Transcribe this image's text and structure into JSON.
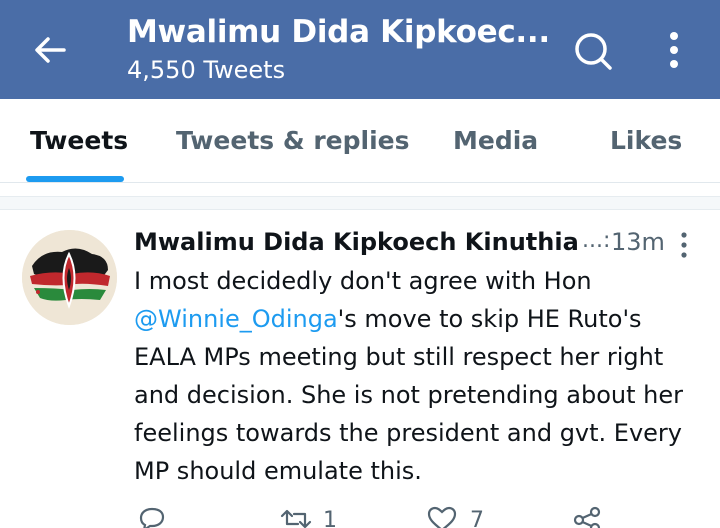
{
  "header": {
    "title": "Mwalimu Dida Kipkoec...",
    "subtitle": "4,550 Tweets",
    "back_icon": "arrow-left-icon",
    "search_icon": "search-icon",
    "more_icon": "more-vertical-icon",
    "background_color": "#4a6da7"
  },
  "tabs": [
    {
      "label": "Tweets",
      "active": true
    },
    {
      "label": "Tweets & replies",
      "active": false
    },
    {
      "label": "Media",
      "active": false
    },
    {
      "label": "Likes",
      "active": false
    }
  ],
  "tweet": {
    "author": "Mwalimu Dida Kipkoech Kinuthia",
    "ellipsis": "...:",
    "time": "13m",
    "text_before": "I most decidedly don't agree with Hon ",
    "mention": "@Winnie_Odinga",
    "text_after": "'s move to skip HE Ruto's EALA MPs meeting but still respect her right and decision. She is not pretending about her feelings towards the president and gvt. Every MP should emulate this.",
    "actions": {
      "reply_icon": "reply-icon",
      "retweet_icon": "retweet-icon",
      "retweet_count": "1",
      "like_icon": "heart-icon",
      "like_count": "7",
      "share_icon": "share-icon"
    }
  },
  "colors": {
    "accent": "#1d9bf0",
    "secondary_text": "#536471"
  }
}
